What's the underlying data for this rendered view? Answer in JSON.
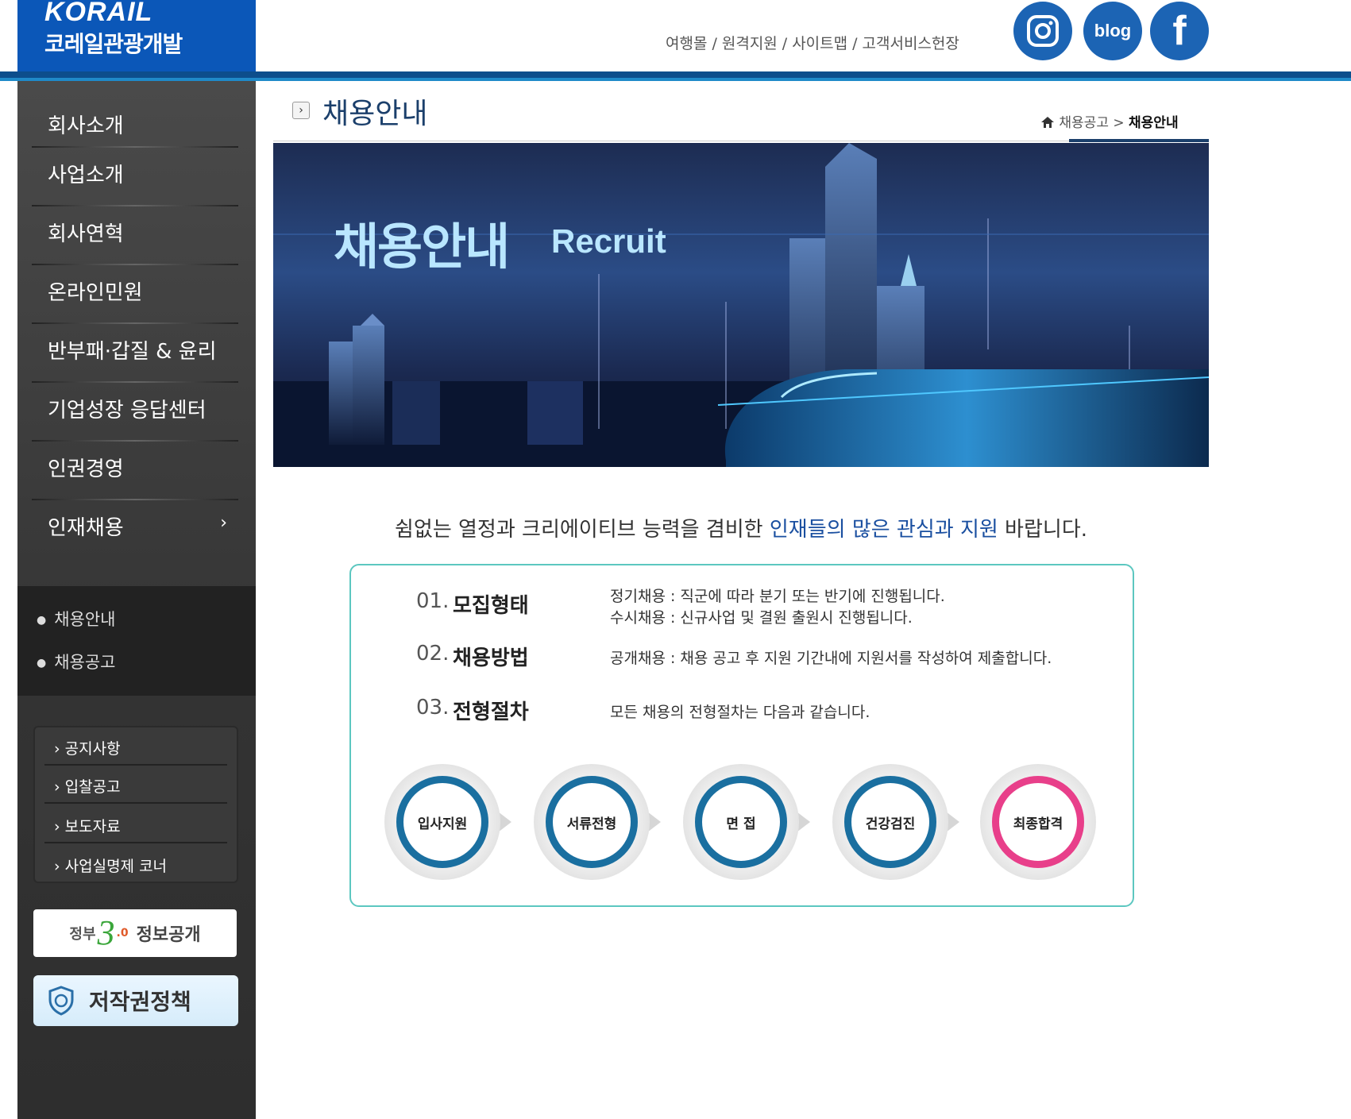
{
  "header": {
    "logo_en": "KORAIL",
    "logo_ko": "코레일관광개발",
    "top_links": [
      "여행몰",
      "원격지원",
      "사이트맵",
      "고객서비스헌장"
    ],
    "social": [
      {
        "name": "instagram",
        "icon": "instagram-icon"
      },
      {
        "name": "blog",
        "label": "blog"
      },
      {
        "name": "facebook",
        "label": "f"
      }
    ]
  },
  "sidebar": {
    "menu": [
      "회사소개",
      "사업소개",
      "회사연혁",
      "온라인민원",
      "반부패·갑질 & 윤리",
      "기업성장 응답센터",
      "인권경영",
      "인재채용"
    ],
    "menu_active_chevron": "›",
    "submenu": [
      "채용안내",
      "채용공고"
    ],
    "quick_links": [
      "공지사항",
      "입찰공고",
      "보도자료",
      "사업실명제 코너"
    ],
    "gov_button": {
      "a": "정부",
      "b": "3",
      "c": ".0",
      "d": "정보공개"
    },
    "copyright_button": "저작권정책"
  },
  "content": {
    "title": "채용안내",
    "breadcrumb": {
      "parent": "채용공고",
      "sep": ">",
      "current": "채용안내"
    },
    "banner": {
      "title_ko": "채용안내",
      "title_en": "Recruit"
    },
    "intro": {
      "before": "쉼없는 열정과 크리에이티브 능력을 겸비한 ",
      "highlight": "인재들의 많은 관심과 지원",
      "after": " 바랍니다."
    },
    "rows": [
      {
        "num": "01.",
        "title": "모집형태",
        "desc": [
          "정기채용 : 직군에 따라 분기 또는 반기에 진행됩니다.",
          "수시채용 : 신규사업 및 결원 출원시 진행됩니다."
        ]
      },
      {
        "num": "02.",
        "title": "채용방법",
        "desc": [
          "공개채용 : 채용 공고 후 지원 기간내에 지원서를 작성하여 제출합니다."
        ]
      },
      {
        "num": "03.",
        "title": "전형절차",
        "desc": [
          "모든 채용의 전형절차는 다음과 같습니다."
        ]
      }
    ],
    "steps": [
      "입사지원",
      "서류전형",
      "면 접",
      "건강검진",
      "최종합격"
    ]
  }
}
